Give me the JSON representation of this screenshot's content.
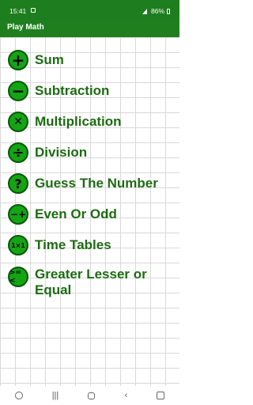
{
  "status_bar": {
    "time": "15:41",
    "battery": "86%"
  },
  "app_bar": {
    "title": "Play Math"
  },
  "menu": [
    {
      "label": "Sum",
      "icon": "plus-icon",
      "glyph": "+"
    },
    {
      "label": "Subtraction",
      "icon": "minus-icon",
      "glyph": "−"
    },
    {
      "label": "Multiplication",
      "icon": "multiply-icon",
      "glyph": "✕"
    },
    {
      "label": "Division",
      "icon": "divide-icon",
      "glyph": "÷"
    },
    {
      "label": "Guess The Number",
      "icon": "question-icon",
      "glyph": "?"
    },
    {
      "label": "Even Or Odd",
      "icon": "even-odd-icon",
      "glyph": "−+"
    },
    {
      "label": "Time Tables",
      "icon": "times-table-icon",
      "glyph": "1×1"
    },
    {
      "label": "Greater Lesser or Equal",
      "icon": "compare-icon",
      "glyph": ">=<"
    }
  ],
  "colors": {
    "accent": "#1e7d1e",
    "label": "#1d6b12",
    "icon_fill": "#14a414"
  }
}
